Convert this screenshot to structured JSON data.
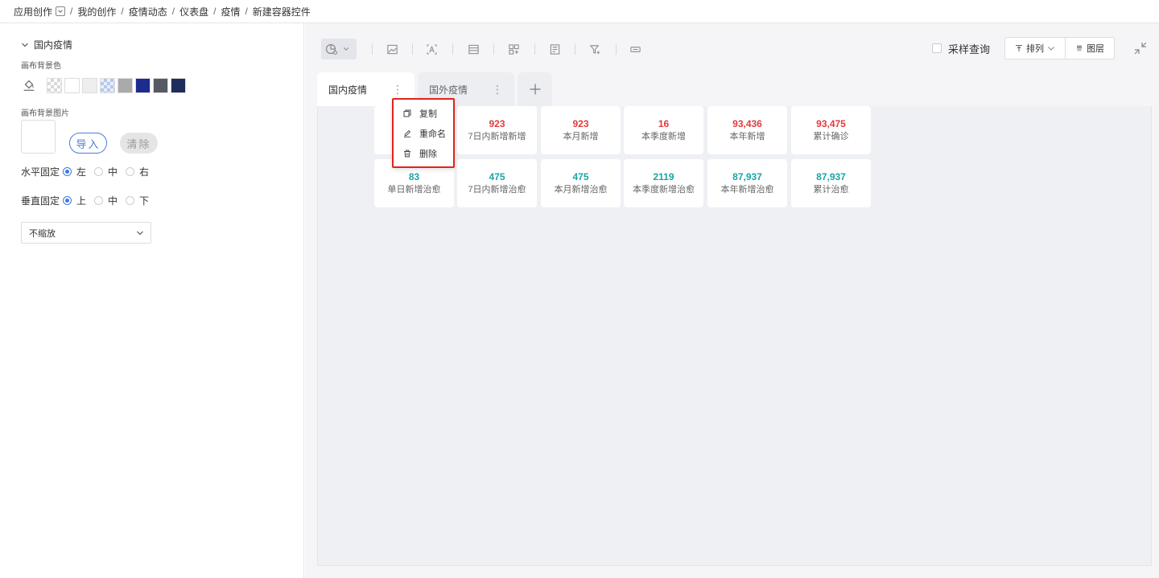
{
  "breadcrumb": {
    "items": [
      "应用创作",
      "我的创作",
      "疫情动态",
      "仪表盘",
      "疫情",
      "新建容器控件"
    ],
    "separator": "/"
  },
  "left_panel": {
    "section_title": "国内疫情",
    "bg_color_label": "画布背景色",
    "bg_image_label": "画布背景图片",
    "import_label": "导入",
    "clear_label": "清除",
    "swatch_colors": [
      "#ffffff",
      "#eeeeee",
      "#aaaaaa",
      "#1d2b8f",
      "#565a63",
      "#1f2d5c"
    ],
    "horizontal": {
      "label": "水平固定",
      "options": [
        "左",
        "中",
        "右"
      ],
      "selected": "左"
    },
    "vertical": {
      "label": "垂直固定",
      "options": [
        "上",
        "中",
        "下"
      ],
      "selected": "上"
    },
    "scale_select": {
      "value": "不缩放"
    }
  },
  "toolbar": {
    "sample_query_label": "采样查询",
    "sort_label": "排列",
    "layers_label": "图层"
  },
  "tabs": [
    {
      "label": "国内疫情",
      "active": true
    },
    {
      "label": "国外疫情",
      "active": false
    }
  ],
  "context_menu": {
    "items": [
      {
        "label": "复制",
        "icon": "copy-icon"
      },
      {
        "label": "重命名",
        "icon": "edit-icon"
      },
      {
        "label": "删除",
        "icon": "trash-icon"
      }
    ]
  },
  "kpi_colors": {
    "red": "#e23a3a",
    "teal": "#1aa5a5"
  },
  "kpi_row1": [
    {
      "value": "923",
      "label": "7日内新增新增"
    },
    {
      "value": "923",
      "label": "本月新增"
    },
    {
      "value": "16",
      "label": "本季度新增"
    },
    {
      "value": "93,436",
      "label": "本年新增"
    },
    {
      "value": "93,475",
      "label": "累计确诊"
    }
  ],
  "kpi_row2": [
    {
      "value": "83",
      "label": "单日新增治愈"
    },
    {
      "value": "475",
      "label": "7日内新增治愈"
    },
    {
      "value": "475",
      "label": "本月新增治愈"
    },
    {
      "value": "2119",
      "label": "本季度新增治愈"
    },
    {
      "value": "87,937",
      "label": "本年新增治愈"
    },
    {
      "value": "87,937",
      "label": "累计治愈"
    }
  ]
}
